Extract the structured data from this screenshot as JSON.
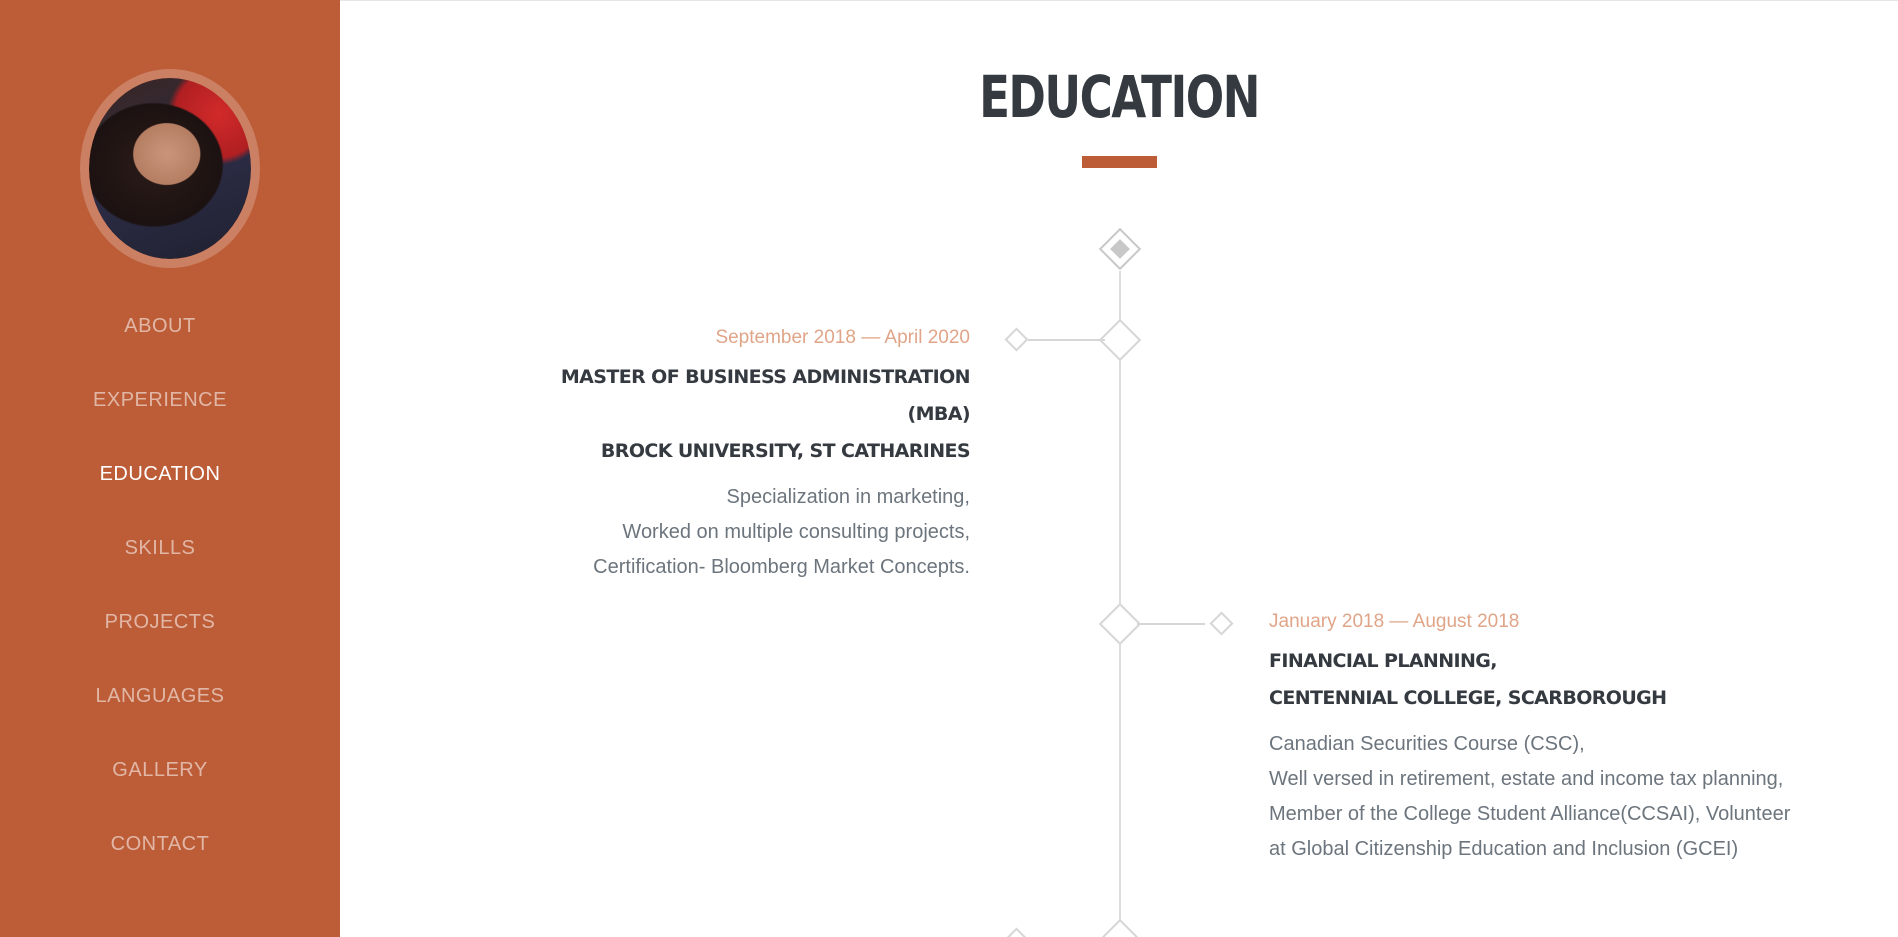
{
  "sidebar": {
    "avatar_alt": "Profile photo",
    "nav": [
      {
        "label": "About",
        "active": false
      },
      {
        "label": "Experience",
        "active": false
      },
      {
        "label": "Education",
        "active": true
      },
      {
        "label": "Skills",
        "active": false
      },
      {
        "label": "Projects",
        "active": false
      },
      {
        "label": "Languages",
        "active": false
      },
      {
        "label": "Gallery",
        "active": false
      },
      {
        "label": "Contact",
        "active": false
      }
    ]
  },
  "main": {
    "title": "EDUCATION",
    "entries": [
      {
        "date": "September 2018 — April 2020",
        "degree": "MASTER OF BUSINESS ADMINISTRATION (MBA)",
        "school": "BROCK UNIVERSITY, ST CATHARINES",
        "lines": [
          "Specialization in marketing,",
          "Worked on multiple consulting projects,",
          "Certification- Bloomberg Market Concepts."
        ]
      },
      {
        "date": "January 2018 — August 2018",
        "degree": "FINANCIAL PLANNING,",
        "school": "CENTENNIAL COLLEGE, SCARBOROUGH",
        "lines": [
          "Canadian Securities Course (CSC),",
          "Well versed in retirement, estate and income tax planning,",
          "Member of the College Student Alliance(CCSAI), Volunteer",
          "at Global Citizenship Education and Inclusion (GCEI)"
        ]
      }
    ]
  },
  "colors": {
    "accent": "#bd5d38",
    "date": "#e0a588",
    "heading": "#343a40",
    "body": "#6c757d"
  }
}
